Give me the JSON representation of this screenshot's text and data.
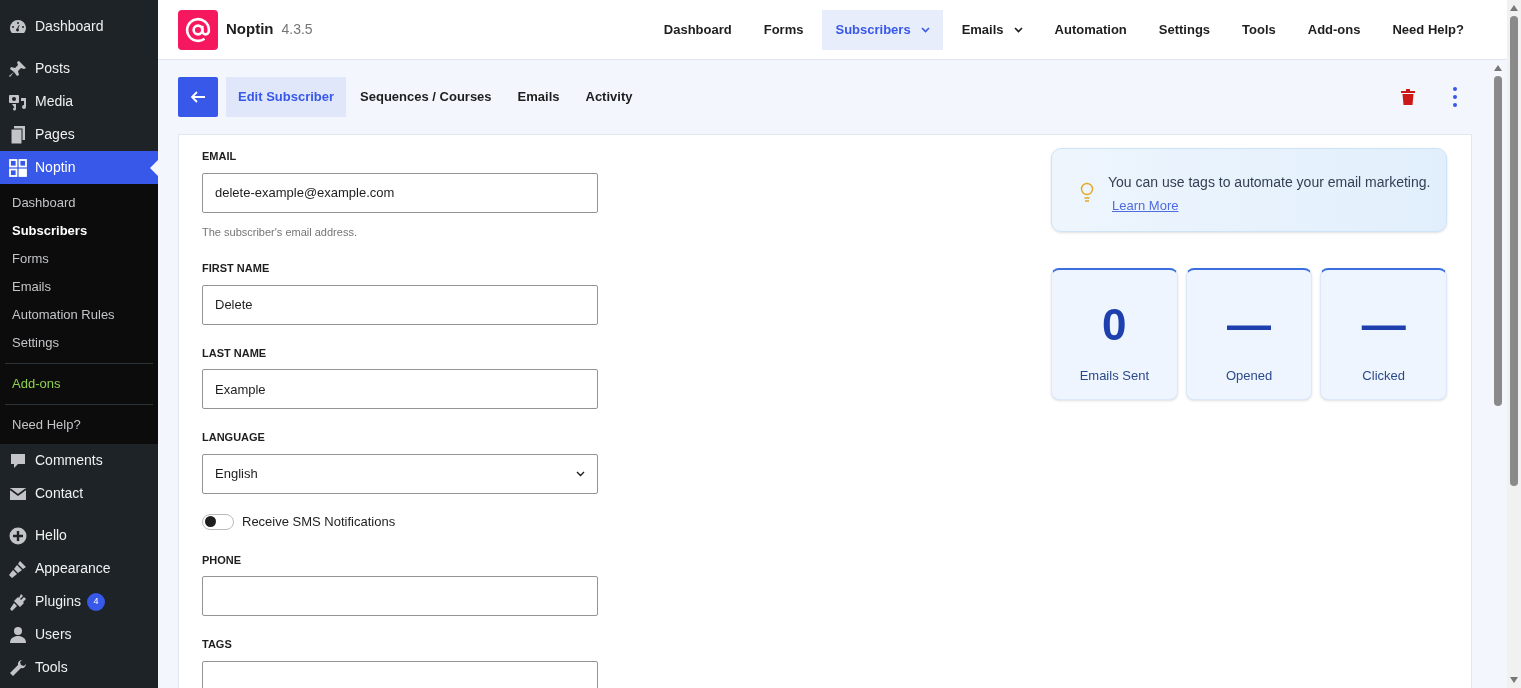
{
  "sidebar": {
    "groups": [
      [
        {
          "label": "Dashboard",
          "selected": false
        }
      ],
      [
        {
          "label": "Posts",
          "selected": false
        },
        {
          "label": "Media",
          "selected": false
        },
        {
          "label": "Pages",
          "selected": false
        },
        {
          "label": "Noptin",
          "selected": true,
          "submenu": [
            [
              {
                "label": "Dashboard",
                "selected": false,
                "kind": "link"
              },
              {
                "label": "Subscribers",
                "selected": true,
                "kind": "link"
              },
              {
                "label": "Forms",
                "selected": false,
                "kind": "link"
              },
              {
                "label": "Emails",
                "selected": false,
                "kind": "link"
              },
              {
                "label": "Automation Rules",
                "selected": false,
                "kind": "link"
              },
              {
                "label": "Settings",
                "selected": false,
                "kind": "link"
              }
            ],
            [
              {
                "label": "Add-ons",
                "selected": false,
                "kind": "upsell"
              }
            ],
            [
              {
                "label": "Need Help?",
                "selected": false,
                "kind": "link"
              }
            ]
          ]
        },
        {
          "label": "Comments",
          "selected": false
        },
        {
          "label": "Contact",
          "selected": false
        }
      ],
      [
        {
          "label": "Hello",
          "selected": false
        },
        {
          "label": "Appearance",
          "selected": false
        },
        {
          "label": "Plugins",
          "selected": false,
          "badge": "4"
        },
        {
          "label": "Users",
          "selected": false
        },
        {
          "label": "Tools",
          "selected": false
        }
      ]
    ]
  },
  "header": {
    "app_name": "Noptin",
    "version": "4.3.5",
    "nav": [
      {
        "label": "Dashboard",
        "selected": false,
        "dropdown": false
      },
      {
        "label": "Forms",
        "selected": false,
        "dropdown": false
      },
      {
        "label": "Subscribers",
        "selected": true,
        "dropdown": true
      },
      {
        "label": "Emails",
        "selected": false,
        "dropdown": true
      },
      {
        "label": "Automation",
        "selected": false,
        "dropdown": false
      },
      {
        "label": "Settings",
        "selected": false,
        "dropdown": false
      },
      {
        "label": "Tools",
        "selected": false,
        "dropdown": false
      },
      {
        "label": "Add-ons",
        "selected": false,
        "dropdown": false
      },
      {
        "label": "Need Help?",
        "selected": false,
        "dropdown": false
      }
    ]
  },
  "tabs": [
    {
      "label": "Edit Subscriber",
      "selected": true
    },
    {
      "label": "Sequences / Courses",
      "selected": false
    },
    {
      "label": "Emails",
      "selected": false
    },
    {
      "label": "Activity",
      "selected": false
    }
  ],
  "form": {
    "fields": [
      {
        "kind": "text",
        "label": "EMAIL",
        "value": "delete-example@example.com",
        "help": "The subscriber's email address."
      },
      {
        "kind": "text",
        "label": "FIRST NAME",
        "value": "Delete"
      },
      {
        "kind": "text",
        "label": "LAST NAME",
        "value": "Example"
      },
      {
        "kind": "select",
        "label": "LANGUAGE",
        "value": "English"
      },
      {
        "kind": "toggle",
        "label": "Receive SMS Notifications",
        "on": false
      },
      {
        "kind": "text",
        "label": "PHONE"
      },
      {
        "kind": "text",
        "label": "TAGS"
      }
    ]
  },
  "tip": {
    "text": "You can use tags to automate your email marketing.",
    "link": "Learn More"
  },
  "stats": [
    {
      "value": "0",
      "label": "Emails Sent"
    },
    {
      "value": "—",
      "label": "Opened"
    },
    {
      "value": "—",
      "label": "Clicked"
    }
  ]
}
